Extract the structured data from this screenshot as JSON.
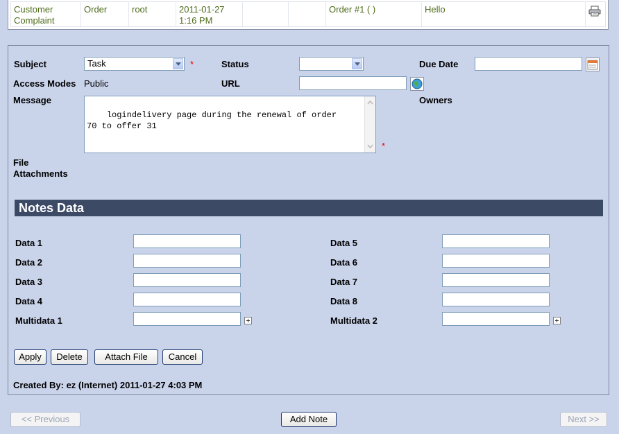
{
  "top_row": {
    "type": "Customer Complaint",
    "type_line1": "Customer",
    "type_line2": "Complaint",
    "regarding": "Order",
    "user": "root",
    "date_line1": "2011-01-27",
    "date_line2": "1:16 PM",
    "col5": "",
    "col6": "",
    "subject": "Order #1 ( )",
    "message": "Hello",
    "print_icon": "printer-icon"
  },
  "form": {
    "subject_label": "Subject",
    "subject_value": "Task",
    "status_label": "Status",
    "status_value": "",
    "due_date_label": "Due Date",
    "due_date_value": "",
    "access_modes_label": "Access Modes",
    "access_modes_value": "Public",
    "url_label": "URL",
    "url_value": "",
    "message_label": "Message",
    "message_value": "logindelivery page during the renewal of order\n70 to offer 31",
    "owners_label": "Owners",
    "file_attachments_label": "File Attachments",
    "file_attachments_line1": "File",
    "file_attachments_line2": "Attachments",
    "required_mark": "*"
  },
  "notes": {
    "title": "Notes Data",
    "left": [
      {
        "label": "Data 1",
        "value": ""
      },
      {
        "label": "Data 2",
        "value": ""
      },
      {
        "label": "Data 3",
        "value": ""
      },
      {
        "label": "Data 4",
        "value": ""
      },
      {
        "label": "Multidata 1",
        "value": ""
      }
    ],
    "right": [
      {
        "label": "Data 5",
        "value": ""
      },
      {
        "label": "Data 6",
        "value": ""
      },
      {
        "label": "Data 7",
        "value": ""
      },
      {
        "label": "Data 8",
        "value": ""
      },
      {
        "label": "Multidata 2",
        "value": ""
      }
    ]
  },
  "actions": {
    "apply": "Apply",
    "delete": "Delete",
    "attach_file": "Attach File",
    "cancel": "Cancel"
  },
  "created_by": "Created By: ez (Internet) 2011-01-27 4:03 PM",
  "nav": {
    "previous": "<< Previous",
    "add_note": "Add Note",
    "next": "Next >>"
  },
  "colors": {
    "background": "#c9d3ea",
    "section_bar": "#3d4a66",
    "list_text": "#4d6b1a",
    "required": "#ee0000"
  }
}
